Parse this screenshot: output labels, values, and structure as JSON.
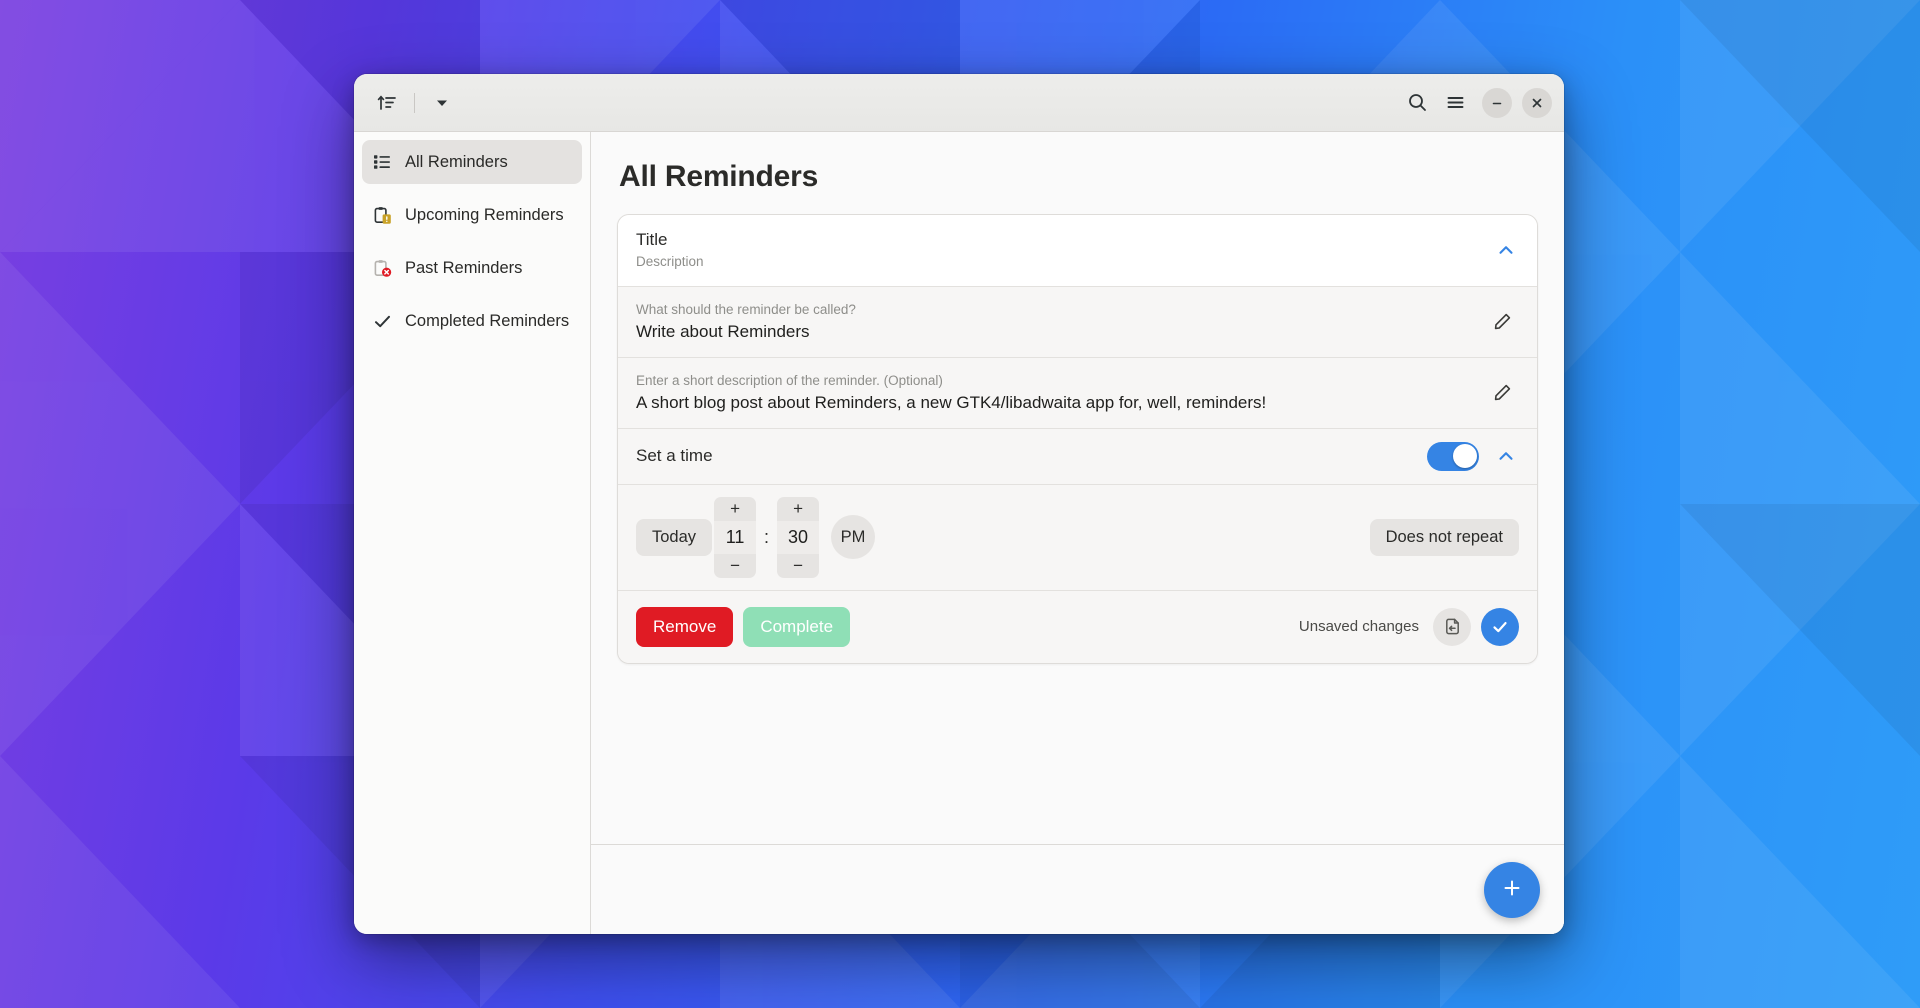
{
  "window": {
    "header": {
      "sort_icon": "sort-ascending-icon",
      "dropdown_icon": "chevron-down-icon",
      "search_icon": "search-icon",
      "menu_icon": "hamburger-menu-icon",
      "minimize_label": "–",
      "close_label": "×"
    }
  },
  "sidebar": {
    "items": [
      {
        "label": "All Reminders",
        "icon": "list-bullet-icon",
        "selected": true
      },
      {
        "label": "Upcoming Reminders",
        "icon": "clipboard-warning-icon",
        "selected": false
      },
      {
        "label": "Past Reminders",
        "icon": "clipboard-overdue-icon",
        "selected": false
      },
      {
        "label": "Completed Reminders",
        "icon": "check-icon",
        "selected": false
      }
    ]
  },
  "main": {
    "page_title": "All Reminders",
    "card": {
      "header": {
        "title": "Title",
        "description": "Description",
        "expander_icon": "chevron-up-icon"
      },
      "title_field": {
        "caption": "What should the reminder be called?",
        "value": "Write about Reminders",
        "edit_icon": "pencil-icon"
      },
      "description_field": {
        "caption": "Enter a short description of the reminder. (Optional)",
        "value": "A short blog post about Reminders, a new GTK4/libadwaita app for, well, reminders!",
        "edit_icon": "pencil-icon"
      },
      "set_time": {
        "label": "Set a time",
        "toggle_on": true,
        "expander_icon": "chevron-up-icon"
      },
      "time": {
        "day_label": "Today",
        "hour": "11",
        "separator": ":",
        "minute": "30",
        "meridiem": "PM",
        "increment_label": "+",
        "decrement_label": "−",
        "repeat_label": "Does not repeat"
      },
      "actions": {
        "remove_label": "Remove",
        "complete_label": "Complete",
        "status_text": "Unsaved changes",
        "revert_icon": "document-revert-icon",
        "confirm_icon": "check-icon"
      }
    }
  },
  "bottom": {
    "add_label": "+",
    "add_icon": "plus-icon"
  },
  "colors": {
    "accent_blue": "#3584e4",
    "destructive_red": "#e01b24",
    "success_green": "#8fdfb6",
    "warning_yellow": "#c9a227",
    "overdue_red": "#e01b24"
  }
}
